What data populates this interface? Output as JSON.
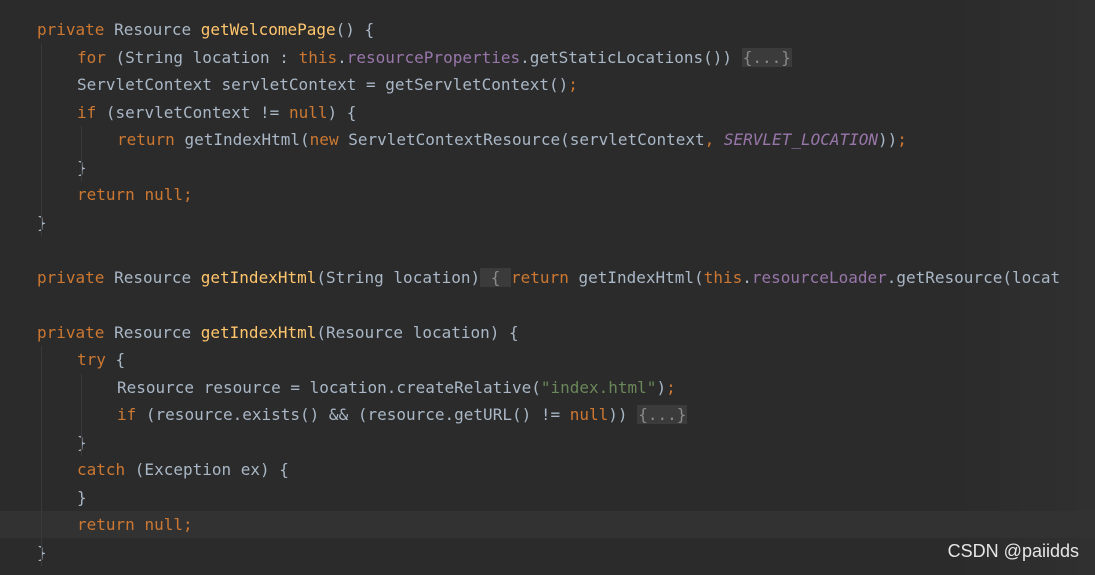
{
  "editor": {
    "lines": [
      {
        "id": "l1",
        "indent": 0,
        "tokens": [
          {
            "t": "private ",
            "c": "kw"
          },
          {
            "t": "Resource ",
            "c": "plain"
          },
          {
            "t": "getWelcomePage",
            "c": "fn"
          },
          {
            "t": "() {",
            "c": "plain"
          }
        ]
      },
      {
        "id": "l2",
        "indent": 1,
        "tokens": [
          {
            "t": "for ",
            "c": "kw"
          },
          {
            "t": "(String location : ",
            "c": "plain"
          },
          {
            "t": "this",
            "c": "kw"
          },
          {
            "t": ".",
            "c": "plain"
          },
          {
            "t": "resourceProperties",
            "c": "field"
          },
          {
            "t": ".getStaticLocations()) ",
            "c": "plain"
          },
          {
            "t": "{...}",
            "c": "fold"
          }
        ]
      },
      {
        "id": "l3",
        "indent": 1,
        "tokens": [
          {
            "t": "ServletContext servletContext = getServletContext()",
            "c": "plain"
          },
          {
            "t": ";",
            "c": "kw"
          }
        ]
      },
      {
        "id": "l4",
        "indent": 1,
        "tokens": [
          {
            "t": "if ",
            "c": "kw"
          },
          {
            "t": "(servletContext != ",
            "c": "plain"
          },
          {
            "t": "null",
            "c": "kw"
          },
          {
            "t": ") {",
            "c": "plain"
          }
        ]
      },
      {
        "id": "l5",
        "indent": 2,
        "tokens": [
          {
            "t": "return ",
            "c": "kw"
          },
          {
            "t": "getIndexHtml(",
            "c": "plain"
          },
          {
            "t": "new ",
            "c": "kw"
          },
          {
            "t": "ServletContextResource(servletContext",
            "c": "plain"
          },
          {
            "t": ", ",
            "c": "kw"
          },
          {
            "t": "SERVLET_LOCATION",
            "c": "const"
          },
          {
            "t": "))",
            "c": "plain"
          },
          {
            "t": ";",
            "c": "kw"
          }
        ]
      },
      {
        "id": "l6",
        "indent": 1,
        "tokens": [
          {
            "t": "}",
            "c": "plain"
          }
        ]
      },
      {
        "id": "l7",
        "indent": 1,
        "tokens": [
          {
            "t": "return ",
            "c": "kw"
          },
          {
            "t": "null;",
            "c": "kw"
          }
        ]
      },
      {
        "id": "l8",
        "indent": 0,
        "tokens": [
          {
            "t": "}",
            "c": "plain"
          }
        ]
      },
      {
        "id": "l9",
        "indent": 0,
        "tokens": []
      },
      {
        "id": "l10",
        "indent": 0,
        "tokens": [
          {
            "t": "private ",
            "c": "kw"
          },
          {
            "t": "Resource ",
            "c": "plain"
          },
          {
            "t": "getIndexHtml",
            "c": "fn"
          },
          {
            "t": "(String location)",
            "c": "plain"
          },
          {
            "t": " { ",
            "c": "fold"
          },
          {
            "t": "return ",
            "c": "kw"
          },
          {
            "t": "getIndexHtml(",
            "c": "plain"
          },
          {
            "t": "this",
            "c": "kw"
          },
          {
            "t": ".",
            "c": "plain"
          },
          {
            "t": "resourceLoader",
            "c": "field"
          },
          {
            "t": ".getResource(locat",
            "c": "plain"
          }
        ]
      },
      {
        "id": "l11",
        "indent": 0,
        "tokens": []
      },
      {
        "id": "l12",
        "indent": 0,
        "tokens": [
          {
            "t": "private ",
            "c": "kw"
          },
          {
            "t": "Resource ",
            "c": "plain"
          },
          {
            "t": "getIndexHtml",
            "c": "fn"
          },
          {
            "t": "(Resource location) {",
            "c": "plain"
          }
        ]
      },
      {
        "id": "l13",
        "indent": 1,
        "tokens": [
          {
            "t": "try ",
            "c": "kw"
          },
          {
            "t": "{",
            "c": "plain"
          }
        ]
      },
      {
        "id": "l14",
        "indent": 2,
        "tokens": [
          {
            "t": "Resource resource = location.createRelative(",
            "c": "plain"
          },
          {
            "t": "\"index.html\"",
            "c": "str"
          },
          {
            "t": ")",
            "c": "plain"
          },
          {
            "t": ";",
            "c": "kw"
          }
        ]
      },
      {
        "id": "l15",
        "indent": 2,
        "tokens": [
          {
            "t": "if ",
            "c": "kw"
          },
          {
            "t": "(resource.exists() && (resource.getURL() != ",
            "c": "plain"
          },
          {
            "t": "null",
            "c": "kw"
          },
          {
            "t": ")) ",
            "c": "plain"
          },
          {
            "t": "{...}",
            "c": "fold"
          }
        ]
      },
      {
        "id": "l16",
        "indent": 1,
        "tokens": [
          {
            "t": "}",
            "c": "plain"
          }
        ]
      },
      {
        "id": "l17",
        "indent": 1,
        "tokens": [
          {
            "t": "catch ",
            "c": "kw"
          },
          {
            "t": "(Exception ex) {",
            "c": "plain"
          }
        ]
      },
      {
        "id": "l18",
        "indent": 1,
        "tokens": [
          {
            "t": "}",
            "c": "plain"
          }
        ]
      },
      {
        "id": "l19",
        "indent": 1,
        "current": true,
        "tokens": [
          {
            "t": "return ",
            "c": "kw"
          },
          {
            "t": "null;",
            "c": "kw"
          }
        ]
      },
      {
        "id": "l20",
        "indent": 0,
        "tokens": [
          {
            "t": "}",
            "c": "plain"
          }
        ]
      }
    ]
  },
  "watermark": "CSDN @paiidds",
  "colors": {
    "background": "#2b2b2b",
    "keyword": "#cc7832",
    "method_declaration": "#ffc66d",
    "field": "#9876aa",
    "string": "#6a8759",
    "default_text": "#a9b7c6",
    "fold_marker_bg": "#3b3b3b",
    "current_line": "#323232"
  }
}
